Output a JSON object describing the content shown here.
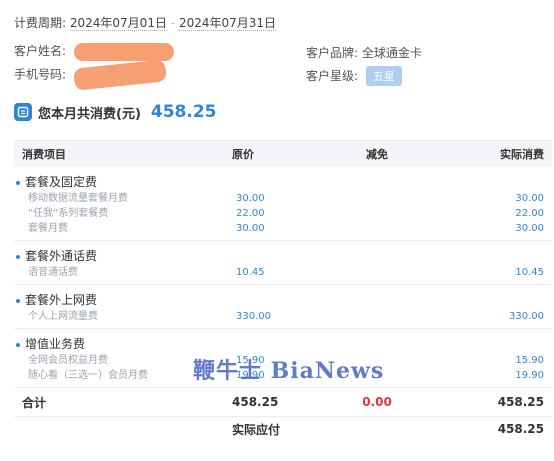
{
  "period": {
    "label": "计费周期:",
    "start": "2024年07月01日",
    "end": "2024年07月31日"
  },
  "customer": {
    "name_label": "客户姓名:",
    "phone_label": "手机号码:",
    "brand_label": "客户品牌:",
    "brand_value": "全球通金卡",
    "star_label": "客户星级:",
    "star_value": "五星"
  },
  "summary": {
    "label": "您本月共消费(元)",
    "amount": "458.25"
  },
  "table": {
    "headers": [
      "消费项目",
      "原价",
      "减免",
      "实际消费"
    ],
    "groups": [
      {
        "title": "套餐及固定费",
        "items": [
          {
            "name": "移动数据流量套餐月费",
            "orig": "30.00",
            "actual": "30.00"
          },
          {
            "name": "“任我”系列套餐费",
            "orig": "22.00",
            "actual": "22.00"
          },
          {
            "name": "套餐月费",
            "orig": "30.00",
            "actual": "30.00"
          }
        ]
      },
      {
        "title": "套餐外通话费",
        "items": [
          {
            "name": "语音通话费",
            "orig": "10.45",
            "actual": "10.45"
          }
        ]
      },
      {
        "title": "套餐外上网费",
        "items": [
          {
            "name": "个人上网流量费",
            "orig": "330.00",
            "actual": "330.00"
          }
        ]
      },
      {
        "title": "增值业务费",
        "items": [
          {
            "name": "全网会员权益月费",
            "orig": "15.90",
            "actual": "15.90"
          },
          {
            "name": "随心看（三选一）会员月费",
            "orig": "19.90",
            "actual": "19.90"
          }
        ]
      }
    ],
    "total": {
      "label": "合计",
      "orig": "458.25",
      "reduce": "0.00",
      "actual": "458.25"
    },
    "payable": {
      "label": "实际应付",
      "actual": "458.25"
    }
  },
  "watermark": "鞭牛士 BiaNews",
  "colors": {
    "accent": "#2f86d6",
    "reduce": "#e0373b",
    "redaction": "#f59a6b"
  }
}
